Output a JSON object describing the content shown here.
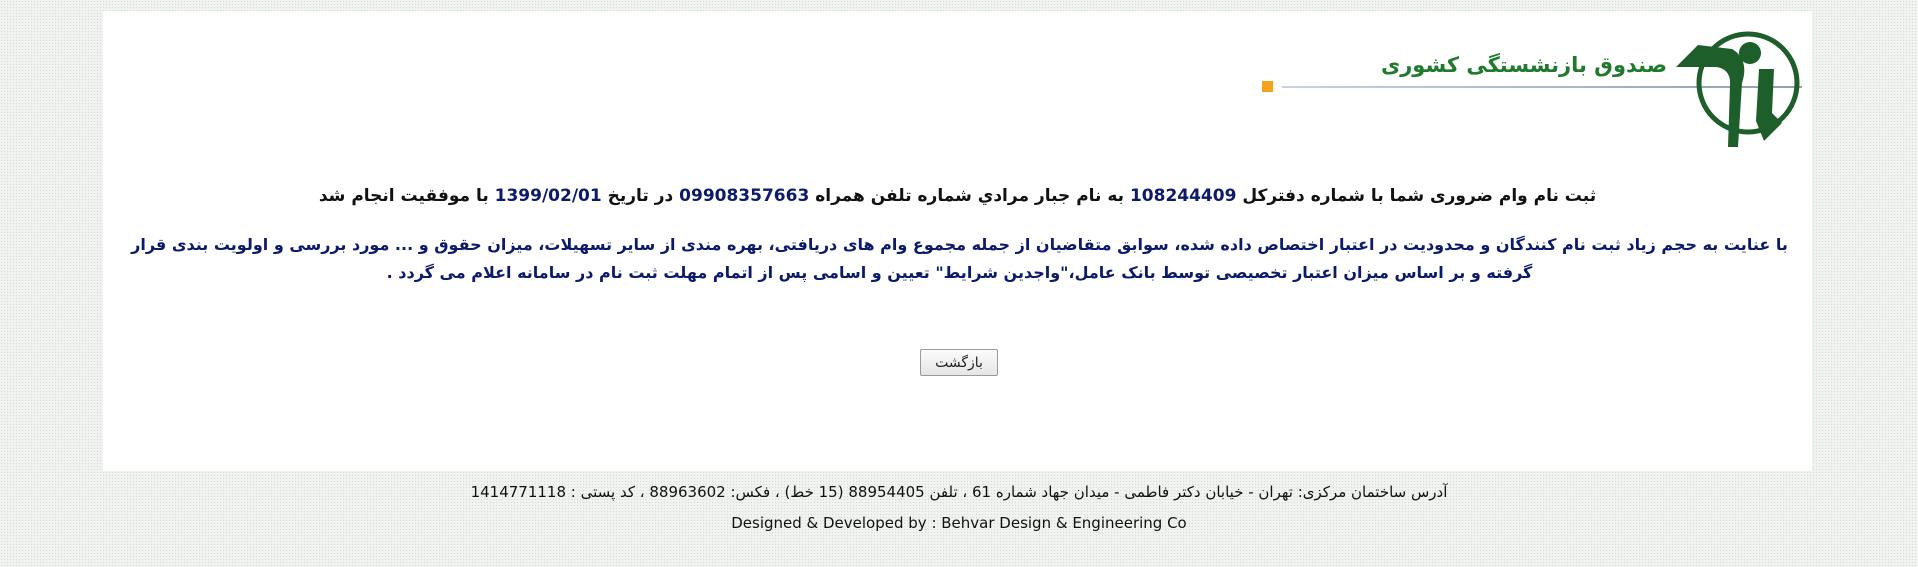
{
  "header": {
    "logo_text": "صندوق بازنشستگی کشوری"
  },
  "message": {
    "line1_prefix": "ثبت نام وام ضروری شما با شماره دفترکل",
    "ledger_number": "108244409",
    "line1_mid1": "به نام جبار مرادي شماره تلفن همراه",
    "phone": "09908357663",
    "line1_mid2": "در تاریخ",
    "date": "1399/02/01",
    "line1_suffix": "با موفقیت انجام شد",
    "line2": "با عنایت به حجم زیاد ثبت نام کنندگان و محدودیت در اعتبار اختصاص داده شده، سوابق متقاضیان از جمله مجموع وام های دریافتی، بهره مندی از سایر تسهیلات، میزان حقوق و ... مورد بررسی و اولویت بندی قرار گرفته و بر اساس میزان اعتبار تخصیصی توسط بانک عامل،\"واجدین شرایط\" تعیین و اسامی پس از اتمام مهلت ثبت نام در سامانه اعلام می گردد ."
  },
  "actions": {
    "back_label": "بازگشت"
  },
  "footer": {
    "address": "آدرس ساختمان مرکزی: تهران - خیابان دکتر فاطمی - میدان جهاد شماره 61 ، تلفن 88954405 (15 خط) ، فکس: 88963602 ، کد پستی : 1414771118",
    "credit": "Designed & Developed by : Behvar Design & Engineering Co"
  },
  "colors": {
    "brand_green": "#1f7a2e",
    "emblem_green": "#1d5e2a",
    "accent_orange": "#f4a21b",
    "message_blue": "#0b1a6b"
  }
}
